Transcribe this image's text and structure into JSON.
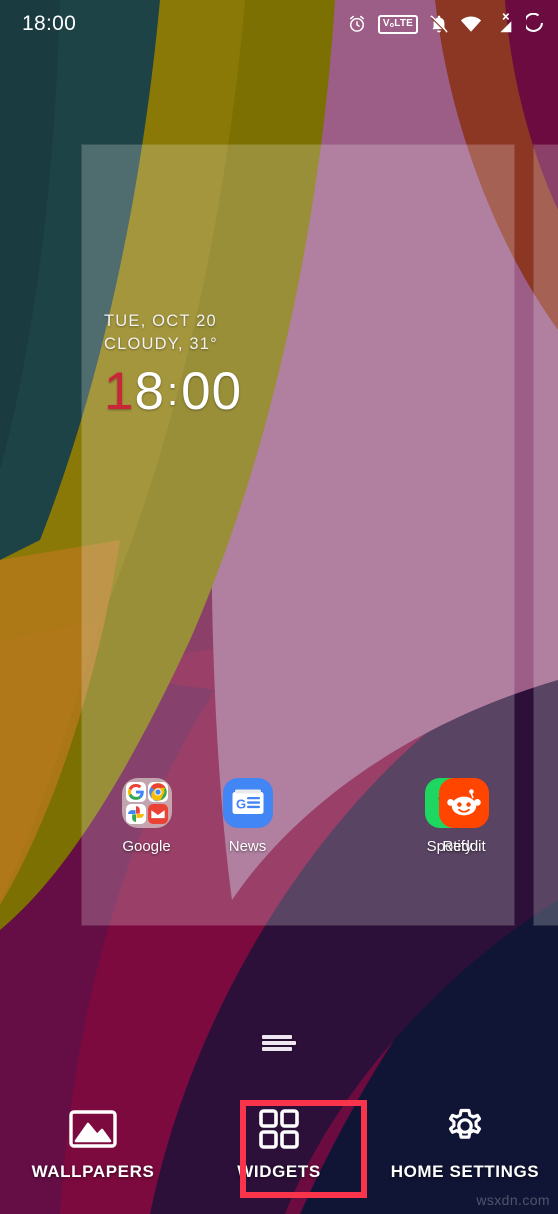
{
  "status_bar": {
    "clock": "18:00",
    "icons": [
      {
        "name": "alarm-icon",
        "label": "alarm"
      },
      {
        "name": "volte-icon",
        "label": "VoLTE"
      },
      {
        "name": "notifications-silenced-icon",
        "label": "silent"
      },
      {
        "name": "wifi-icon",
        "label": "wifi"
      },
      {
        "name": "mobile-signal-off-icon",
        "label": "signal-x"
      },
      {
        "name": "battery-icon",
        "label": "battery"
      }
    ],
    "volte_main": "V",
    "volte_sub": "o",
    "volte_tail": "LTE"
  },
  "clock_widget": {
    "date": "TUE, OCT 20",
    "weather": "CLOUDY, 31°",
    "time_first": "1",
    "time_rest": "8",
    "time_colon": ":",
    "time_minutes": "00",
    "accent_color": "#c9263a"
  },
  "apps": [
    {
      "name": "google-folder",
      "label": "Google",
      "icon": "google-folder-icon"
    },
    {
      "name": "news",
      "label": "News",
      "icon": "google-news-icon"
    },
    {
      "name": "empty",
      "label": "",
      "icon": ""
    },
    {
      "name": "spotify",
      "label": "Spotify",
      "icon": "spotify-icon"
    }
  ],
  "app_labels": {
    "google": "Google",
    "news": "News",
    "spotify": "Spotify",
    "reddit": "Reddit"
  },
  "action_bar": {
    "wallpapers_label": "WALLPAPERS",
    "widgets_label": "WIDGETS",
    "home_settings_label": "HOME SETTINGS",
    "highlight_color": "#f9344b",
    "highlighted_item": "WIDGETS"
  },
  "watermark": "wsxdn.com",
  "wallpaper": {
    "colors": {
      "teal": "#1e4347",
      "olive": "#7d7002",
      "brick": "#8c3624",
      "magenta_dark": "#6b0b3f",
      "ochre": "#b07818",
      "mauve": "#9c5d87",
      "crimson": "#7d0a3e",
      "plum": "#2c1039",
      "navy": "#111535",
      "purple": "#4a2358"
    }
  }
}
